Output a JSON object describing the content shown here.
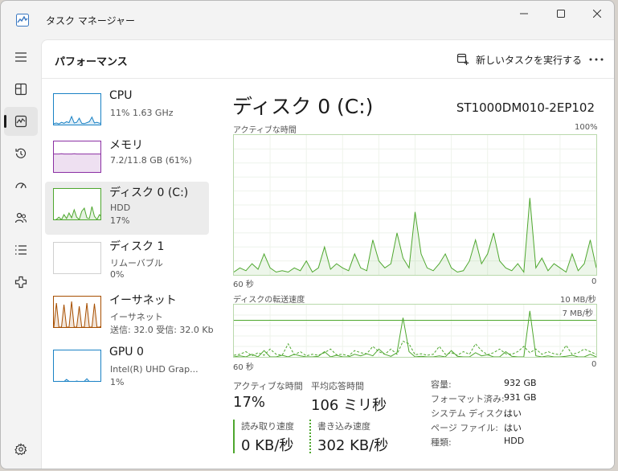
{
  "window": {
    "title": "タスク マネージャー"
  },
  "nav": {
    "items": [
      {
        "icon": "hamburger-menu-icon"
      },
      {
        "icon": "processes-icon"
      },
      {
        "icon": "performance-icon",
        "active": true
      },
      {
        "icon": "app-history-icon"
      },
      {
        "icon": "startup-apps-icon"
      },
      {
        "icon": "users-icon"
      },
      {
        "icon": "details-icon"
      },
      {
        "icon": "services-icon"
      },
      {
        "icon": "settings-icon"
      }
    ]
  },
  "header": {
    "title": "パフォーマンス",
    "run_task_label": "新しいタスクを実行する"
  },
  "resources": [
    {
      "name": "CPU",
      "line1": "11%  1.63 GHz",
      "line2": "",
      "line3": "",
      "color": "#1a82c5",
      "values": [
        8,
        10,
        7,
        12,
        9,
        14,
        11,
        30,
        10,
        12,
        25,
        9,
        8,
        11,
        14,
        28,
        10,
        12,
        9,
        11
      ]
    },
    {
      "name": "メモリ",
      "line1": "7.2/11.8 GB (61%)",
      "line2": "",
      "line3": "",
      "color": "#8b2fa3",
      "values": [
        61,
        61,
        61,
        62,
        61,
        61,
        61,
        61,
        62,
        61,
        61,
        61,
        61,
        61,
        61,
        61,
        61,
        61,
        61,
        61
      ]
    },
    {
      "name": "ディスク 0 (C:)",
      "line1": "HDD",
      "line2": "17%",
      "line3": "",
      "color": "#4ea72e",
      "selected": true,
      "values": [
        3,
        5,
        12,
        4,
        20,
        8,
        25,
        10,
        35,
        12,
        5,
        30,
        40,
        10,
        8,
        45,
        15,
        5,
        20,
        10
      ]
    },
    {
      "name": "ディスク 1",
      "line1": "リムーバブル",
      "line2": "0%",
      "line3": "",
      "color": "#4ea72e",
      "values": [
        0,
        0,
        0,
        0,
        0,
        0,
        0,
        0,
        0,
        0,
        0,
        0,
        0,
        0,
        0,
        0,
        0,
        0,
        0,
        0
      ]
    },
    {
      "name": "イーサネット",
      "line1": "イーサネット",
      "line2": "送信: 32.0  受信: 32.0 Kb",
      "line3": "",
      "color": "#a74f01",
      "values": [
        5,
        80,
        5,
        5,
        75,
        5,
        5,
        85,
        5,
        5,
        70,
        5,
        5,
        80,
        5,
        5,
        78,
        5,
        5,
        10
      ]
    },
    {
      "name": "GPU 0",
      "line1": "Intel(R) UHD Grap...",
      "line2": "1%",
      "line3": "",
      "color": "#1a82c5",
      "values": [
        2,
        3,
        4,
        2,
        3,
        10,
        4,
        3,
        2,
        5,
        3,
        2,
        4,
        12,
        3,
        2,
        4,
        3,
        2,
        3
      ]
    }
  ],
  "detail": {
    "title": "ディスク 0 (C:)",
    "model": "ST1000DM010-2EP102",
    "active_time_graph": {
      "label": "アクティブな時間",
      "max_label": "100%",
      "x_left_label": "60 秒",
      "x_right_label": "0"
    },
    "transfer_graph": {
      "label": "ディスクの転送速度",
      "max_label": "10 MB/秒",
      "line_label": "7 MB/秒",
      "x_left_label": "60 秒",
      "x_right_label": "0"
    },
    "stats": {
      "active_time_label": "アクティブな時間",
      "active_time_value": "17%",
      "avg_response_label": "平均応答時間",
      "avg_response_value": "106 ミリ秒",
      "read_label": "読み取り速度",
      "read_value": "0 KB/秒",
      "write_label": "書き込み速度",
      "write_value": "302 KB/秒"
    },
    "properties": [
      {
        "key": "容量:",
        "value": "932 GB"
      },
      {
        "key": "フォーマット済み:",
        "value": "931 GB"
      },
      {
        "key": "システム ディスク:",
        "value": "はい"
      },
      {
        "key": "ページ ファイル:",
        "value": "はい"
      },
      {
        "key": "種類:",
        "value": "HDD"
      }
    ]
  },
  "chart_data": [
    {
      "type": "area",
      "title": "",
      "xlabel": "",
      "ylabel": "アクティブな時間",
      "x": [
        -60,
        -59,
        -58,
        -57,
        -56,
        -55,
        -54,
        -53,
        -52,
        -51,
        -50,
        -49,
        -48,
        -47,
        -46,
        -45,
        -44,
        -43,
        -42,
        -41,
        -40,
        -39,
        -38,
        -37,
        -36,
        -35,
        -34,
        -33,
        -32,
        -31,
        -30,
        -29,
        -28,
        -27,
        -26,
        -25,
        -24,
        -23,
        -22,
        -21,
        -20,
        -19,
        -18,
        -17,
        -16,
        -15,
        -14,
        -13,
        -12,
        -11,
        -10,
        -9,
        -8,
        -7,
        -6,
        -5,
        -4,
        -3,
        -2,
        -1,
        0
      ],
      "ylim": [
        0,
        100
      ],
      "series": [
        {
          "name": "",
          "color": "#4ea72e",
          "values": [
            2,
            5,
            3,
            8,
            4,
            15,
            5,
            2,
            3,
            2,
            5,
            3,
            10,
            2,
            5,
            20,
            4,
            8,
            5,
            3,
            15,
            5,
            3,
            25,
            10,
            5,
            8,
            30,
            12,
            5,
            45,
            15,
            5,
            3,
            8,
            15,
            5,
            2,
            3,
            10,
            25,
            8,
            15,
            30,
            10,
            5,
            3,
            8,
            2,
            55,
            5,
            12,
            3,
            8,
            5,
            2,
            15,
            3,
            8,
            25,
            5
          ]
        }
      ]
    },
    {
      "type": "line",
      "title": "",
      "xlabel": "",
      "ylabel": "ディスクの転送速度",
      "x": [
        -60,
        -59,
        -58,
        -57,
        -56,
        -55,
        -54,
        -53,
        -52,
        -51,
        -50,
        -49,
        -48,
        -47,
        -46,
        -45,
        -44,
        -43,
        -42,
        -41,
        -40,
        -39,
        -38,
        -37,
        -36,
        -35,
        -34,
        -33,
        -32,
        -31,
        -30,
        -29,
        -28,
        -27,
        -26,
        -25,
        -24,
        -23,
        -22,
        -21,
        -20,
        -19,
        -18,
        -17,
        -16,
        -15,
        -14,
        -13,
        -12,
        -11,
        -10,
        -9,
        -8,
        -7,
        -6,
        -5,
        -4,
        -3,
        -2,
        -1,
        0
      ],
      "ylim": [
        0,
        10
      ],
      "reference_line": 7,
      "series": [
        {
          "name": "",
          "color": "#4ea72e",
          "style": "solid",
          "values": [
            0,
            0.2,
            0,
            0.5,
            0,
            1.2,
            0,
            0,
            0.3,
            0,
            0.5,
            0.2,
            0,
            0,
            0.1,
            1.0,
            0,
            0.3,
            0,
            0,
            0.5,
            0.2,
            0.6,
            0.2,
            1.5,
            0.5,
            0.1,
            0.8,
            7.5,
            1.0,
            0,
            0.1,
            0,
            0,
            0.2,
            0,
            1.2,
            0.1,
            0,
            0,
            0.8,
            0.2,
            0.4,
            0,
            0,
            1.0,
            0.1,
            0,
            0,
            8.8,
            0.2,
            0,
            0.2,
            0,
            0,
            0.1,
            0.3,
            0,
            0,
            0.5,
            0
          ]
        },
        {
          "name": "",
          "color": "#4ea72e",
          "style": "dashed",
          "values": [
            0.3,
            0.5,
            1.0,
            0.2,
            0.8,
            0.3,
            1.5,
            0.5,
            0.3,
            2.5,
            0.4,
            1.0,
            0.2,
            0.5,
            0.3,
            0.8,
            1.5,
            0.4,
            0.5,
            0.2,
            1.2,
            0.8,
            0.6,
            2.0,
            1.0,
            0.5,
            1.5,
            0.5,
            3.0,
            2.5,
            0.4,
            0.6,
            0.3,
            0.5,
            2.0,
            0.5,
            0.8,
            0.3,
            1.0,
            0.5,
            2.5,
            1.2,
            0.4,
            0.8,
            1.5,
            0.6,
            0.5,
            1.0,
            2.0,
            0.8,
            1.5,
            0.5,
            1.0,
            0.6,
            0.4,
            2.2,
            0.5,
            0.8,
            1.5,
            1.0,
            0.5
          ]
        }
      ]
    }
  ]
}
